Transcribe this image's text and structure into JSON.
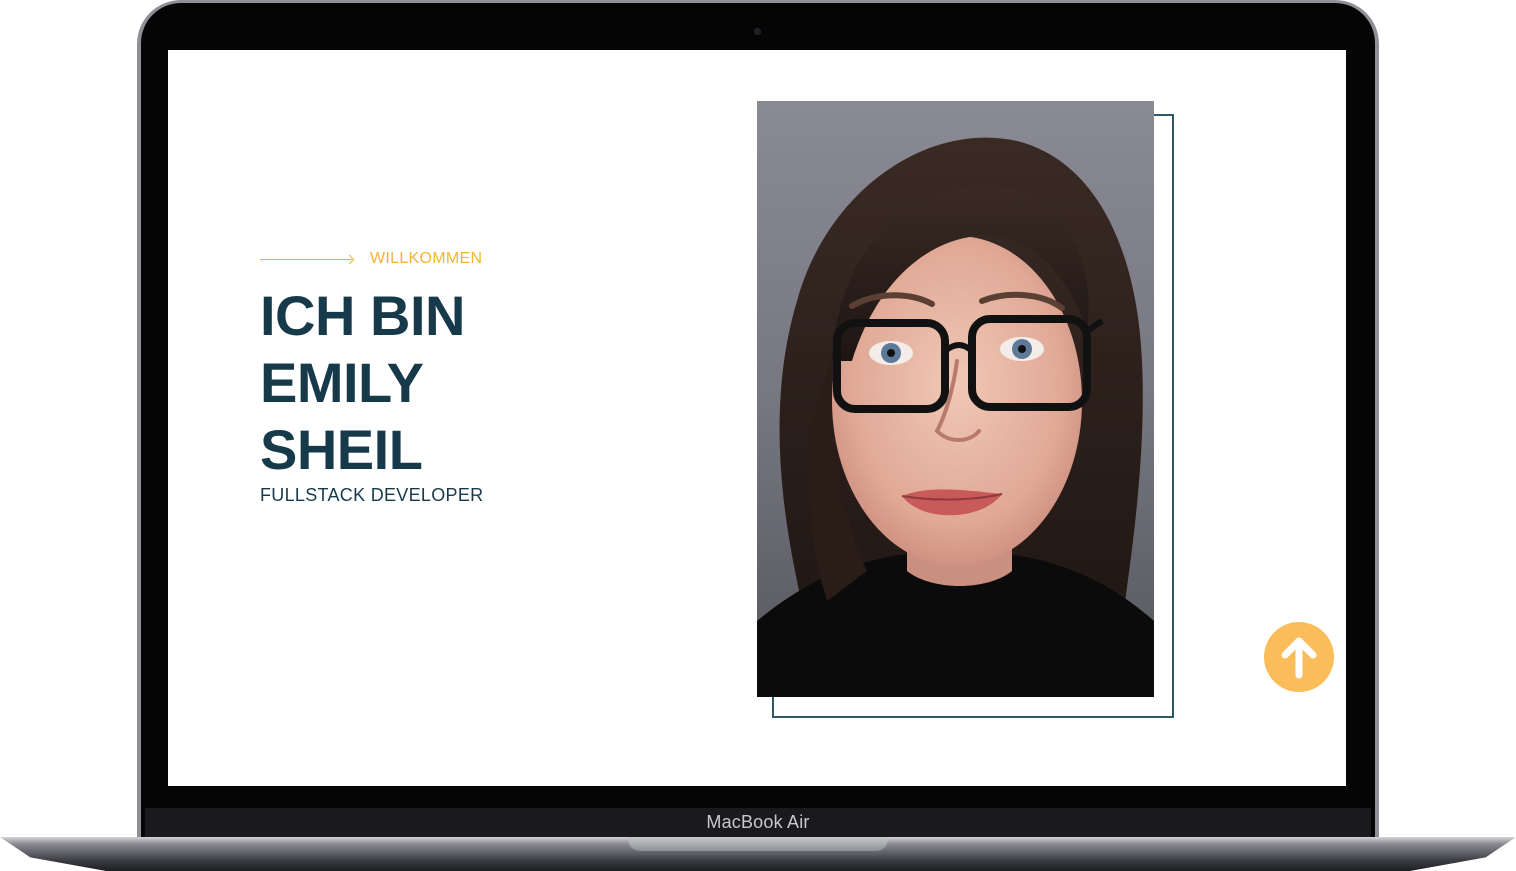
{
  "device": {
    "label": "MacBook Air"
  },
  "hero": {
    "eyebrow": "WILLKOMMEN",
    "headline_lines": [
      "ICH BIN",
      "EMILY",
      "SHEIL"
    ],
    "subtitle": "FULLSTACK DEVELOPER"
  },
  "portrait": {
    "icon": "portrait-photo"
  },
  "scroll_top": {
    "icon": "arrow-up-icon"
  },
  "colors": {
    "accent": "#f5b335",
    "heading": "#173a4a",
    "frame": "#2f5a63",
    "button": "#fbbd59"
  }
}
